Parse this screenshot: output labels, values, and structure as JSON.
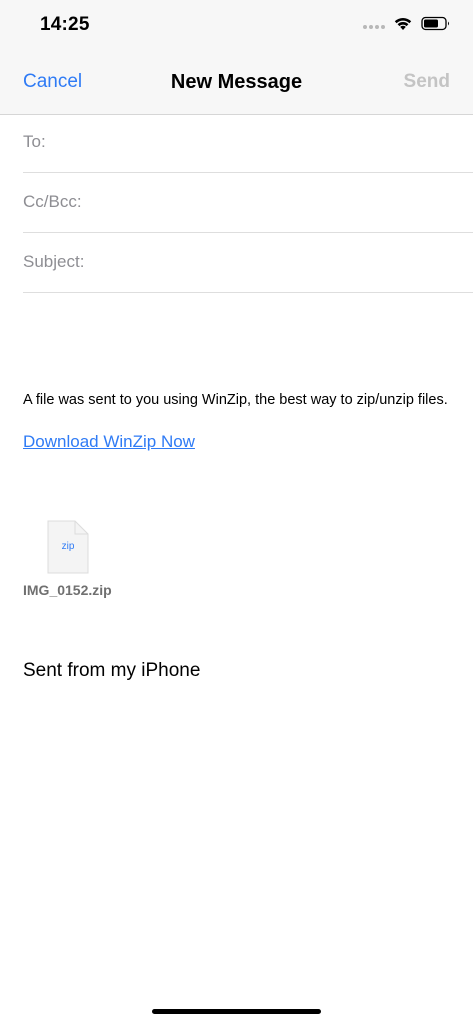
{
  "status_bar": {
    "time": "14:25"
  },
  "nav": {
    "cancel_label": "Cancel",
    "title": "New Message",
    "send_label": "Send"
  },
  "fields": {
    "to_label": "To:",
    "cc_label": "Cc/Bcc:",
    "subject_label": "Subject:",
    "to_value": "",
    "cc_value": "",
    "subject_value": ""
  },
  "body": {
    "message_text": "A file was sent to you using WinZip, the best way to zip/unzip files.",
    "link_text": "Download WinZip Now",
    "attachment": {
      "extension": "zip",
      "file_name": "IMG_0152.zip"
    },
    "signature": "Sent from my iPhone"
  },
  "colors": {
    "accent": "#2f7bf5",
    "disabled": "#c4c4c4",
    "label_gray": "#8e8e93"
  },
  "icons": [
    "signal-dots-icon",
    "wifi-icon",
    "battery-icon",
    "file-icon"
  ]
}
